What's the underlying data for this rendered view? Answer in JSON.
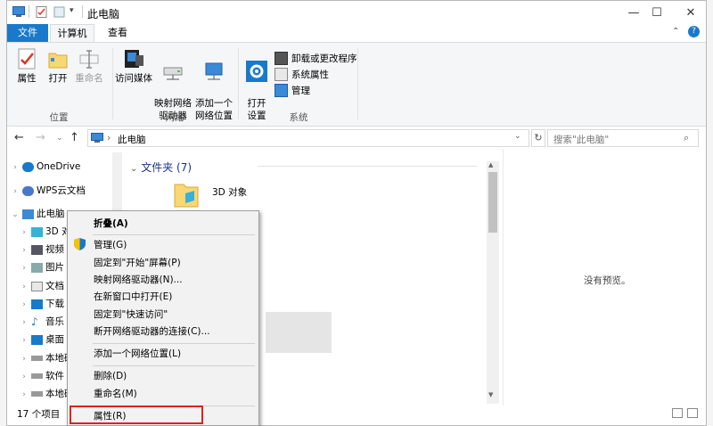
{
  "window": {
    "title": "此电脑"
  },
  "title_buttons": {
    "minimize": "—",
    "maximize": "☐",
    "close": "✕"
  },
  "ribbon_tabs": [
    "文件",
    "计算机",
    "查看"
  ],
  "ribbon": {
    "location": {
      "label": "位置",
      "buttons": [
        "属性",
        "打开",
        "重命名"
      ]
    },
    "network": {
      "label": "网络",
      "buttons": [
        "访问媒体",
        "映射网络\n驱动器",
        "添加一个\n网络位置"
      ]
    },
    "system": {
      "label": "系统",
      "open_settings": "打开\n设置",
      "items": [
        "卸载或更改程序",
        "系统属性",
        "管理"
      ]
    }
  },
  "address": {
    "path": "此电脑",
    "search_placeholder": "搜索\"此电脑\""
  },
  "nav_pane": {
    "items": [
      {
        "label": "OneDrive",
        "icon": "cloud-icon"
      },
      {
        "label": "WPS云文档",
        "icon": "wps-cloud-icon"
      },
      {
        "label": "此电脑",
        "icon": "computer-icon"
      },
      {
        "label": "3D 对",
        "icon": "3d-objects-icon"
      },
      {
        "label": "视频",
        "icon": "video-icon"
      },
      {
        "label": "图片",
        "icon": "picture-icon"
      },
      {
        "label": "文档",
        "icon": "document-icon"
      },
      {
        "label": "下载",
        "icon": "download-icon"
      },
      {
        "label": "音乐",
        "icon": "music-icon"
      },
      {
        "label": "桌面",
        "icon": "desktop-icon"
      },
      {
        "label": "本地磁",
        "icon": "drive-icon"
      },
      {
        "label": "软件",
        "icon": "drive-icon"
      },
      {
        "label": "本地磁",
        "icon": "drive-icon"
      }
    ]
  },
  "content": {
    "group_header": "文件夹 (7)",
    "first_item": "3D 对象"
  },
  "preview": {
    "text": "没有预览。"
  },
  "status": {
    "count": "17 个项目"
  },
  "context_menu": {
    "items": [
      "折叠(A)",
      "管理(G)",
      "固定到\"开始\"屏幕(P)",
      "映射网络驱动器(N)...",
      "在新窗口中打开(E)",
      "固定到\"快速访问\"",
      "断开网络驱动器的连接(C)...",
      "添加一个网络位置(L)",
      "删除(D)",
      "重命名(M)",
      "属性(R)"
    ]
  },
  "colors": {
    "accent": "#1979ca",
    "highlight_box": "#e02020",
    "folder": "#f8d775"
  }
}
